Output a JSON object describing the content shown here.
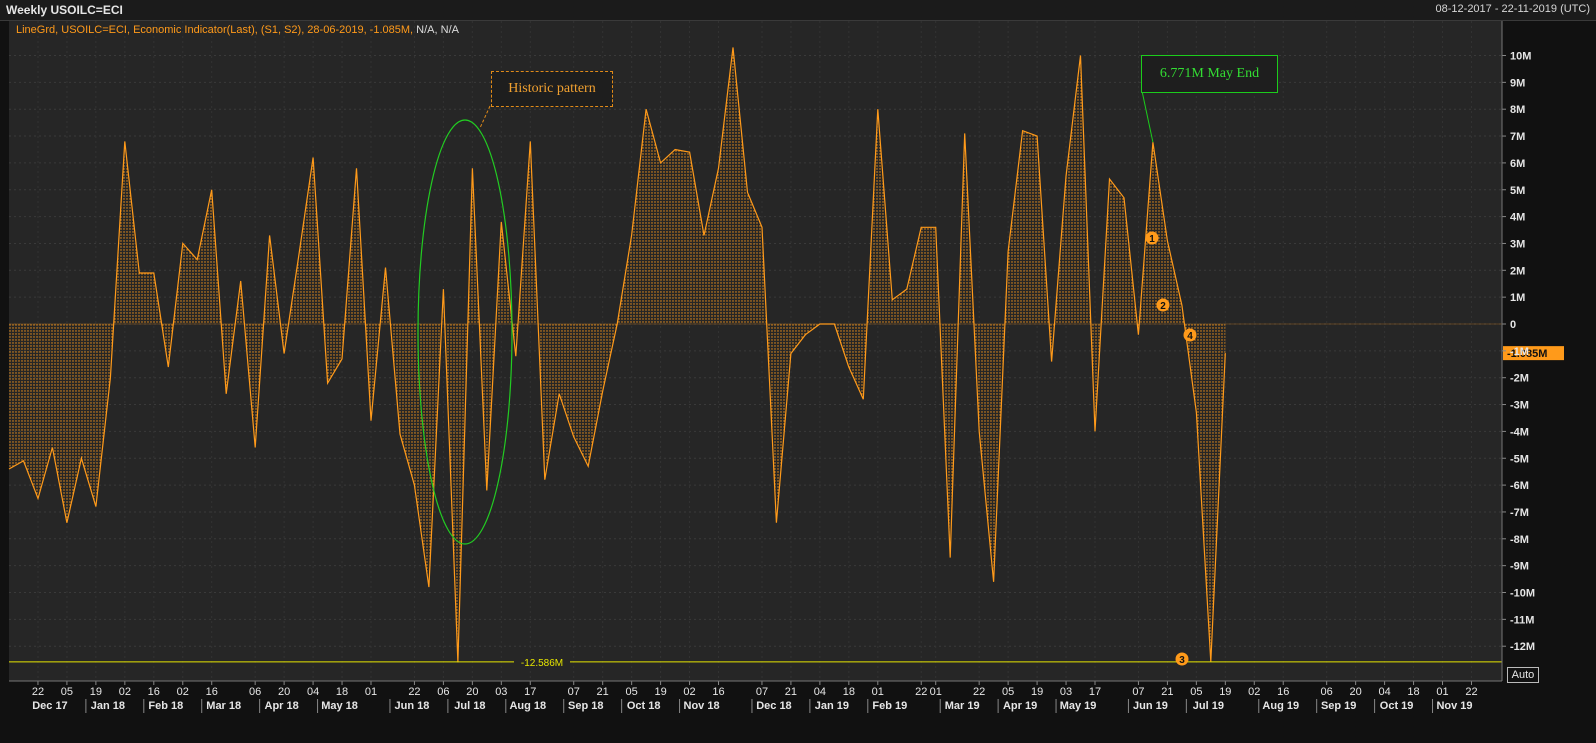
{
  "window": {
    "title": "Weekly USOILC=ECI",
    "date_range": "08-12-2017 - 22-11-2019 (UTC)"
  },
  "legend": {
    "text": "LineGrd, USOILC=ECI, Economic Indicator(Last), (S1, S2), 28-06-2019, -1.085M,",
    "na": "N/A, N/A"
  },
  "annotations": {
    "historic_pattern": "Historic pattern",
    "may_end": "6.771M May End",
    "min_line_label": "-12.586M",
    "last_value_label": "-1.085M",
    "markers": [
      "1",
      "2",
      "3",
      "4"
    ]
  },
  "auto_button": "Auto",
  "colors": {
    "series": "#ff9a1a",
    "ellipse": "#22cc22",
    "min_line": "#e6e600",
    "price_tag": "#ff9a1a"
  },
  "chart_data": {
    "type": "area",
    "title": "Weekly USOILC=ECI",
    "ylim": [
      -13,
      10.5
    ],
    "y_ticks": [
      "10M",
      "9M",
      "8M",
      "7M",
      "6M",
      "5M",
      "4M",
      "3M",
      "2M",
      "1M",
      "0",
      "-1M",
      "-2M",
      "-3M",
      "-4M",
      "-5M",
      "-6M",
      "-7M",
      "-8M",
      "-9M",
      "-10M",
      "-11M",
      "-12M"
    ],
    "y_tick_values": [
      10,
      9,
      8,
      7,
      6,
      5,
      4,
      3,
      2,
      1,
      0,
      -1,
      -2,
      -3,
      -4,
      -5,
      -6,
      -7,
      -8,
      -9,
      -10,
      -11,
      -12
    ],
    "x_day_ticks": [
      "22",
      "05",
      "19",
      "02",
      "16",
      "02",
      "16",
      "06",
      "20",
      "04",
      "18",
      "01",
      "22",
      "06",
      "20",
      "03",
      "17",
      "07",
      "21",
      "05",
      "19",
      "02",
      "16",
      "07",
      "21",
      "04",
      "18",
      "01",
      "22",
      "01",
      "22",
      "05",
      "19",
      "03",
      "17",
      "07",
      "21",
      "05",
      "19",
      "02",
      "16",
      "06",
      "20",
      "04",
      "18",
      "01",
      "22"
    ],
    "x_day_tick_index": [
      2,
      4,
      6,
      8,
      10,
      12,
      14,
      17,
      19,
      21,
      23,
      25,
      28,
      30,
      32,
      34,
      36,
      39,
      41,
      43,
      45,
      47,
      49,
      52,
      54,
      56,
      58,
      60,
      63,
      64,
      67,
      69,
      71,
      73,
      75,
      78,
      80,
      82,
      84,
      86,
      88,
      91,
      93,
      95,
      97,
      99,
      101
    ],
    "x_month_ticks": [
      "Dec 17",
      "Jan 18",
      "Feb 18",
      "Mar 18",
      "Apr 18",
      "May 18",
      "Jun 18",
      "Jul 18",
      "Aug 18",
      "Sep 18",
      "Oct 18",
      "Nov 18",
      "Dec 18",
      "Jan 19",
      "Feb 19",
      "Mar 19",
      "Apr 19",
      "May 19",
      "Jun 19",
      "Jul 19",
      "Aug 19",
      "Sep 19",
      "Oct 19",
      "Nov 19"
    ],
    "x_month_tick_index": [
      2,
      6,
      10,
      14,
      18,
      22,
      27,
      31,
      35,
      39,
      43,
      47,
      52,
      56,
      60,
      65,
      69,
      73,
      78,
      82,
      87,
      91,
      95,
      99
    ],
    "x_count": 103,
    "series": [
      {
        "name": "USOILC=ECI",
        "unit": "M",
        "values": [
          -5.4,
          -5.1,
          -6.5,
          -4.6,
          -7.4,
          -5.0,
          -6.8,
          -2.0,
          6.8,
          1.9,
          1.9,
          -1.6,
          3.0,
          2.4,
          5.0,
          -2.6,
          1.6,
          -4.6,
          3.3,
          -1.1,
          2.5,
          6.2,
          -2.2,
          -1.3,
          5.8,
          -3.6,
          2.1,
          -4.1,
          -6.0,
          -9.8,
          1.3,
          -12.6,
          5.8,
          -6.2,
          3.8,
          -1.2,
          6.8,
          -5.8,
          -2.6,
          -4.2,
          -5.3,
          -2.5,
          0.0,
          3.3,
          8.0,
          6.0,
          6.5,
          6.4,
          3.3,
          5.8,
          10.3,
          4.9,
          3.6,
          -7.4,
          -1.1,
          -0.4,
          0.0,
          0.0,
          -1.6,
          -2.8,
          8.0,
          0.9,
          1.3,
          3.6,
          3.6,
          -8.7,
          7.1,
          -4.0,
          -9.6,
          2.7,
          7.2,
          7.0,
          -1.4,
          5.5,
          10.0,
          -4.0,
          5.4,
          4.7,
          -0.4,
          6.771,
          3.1,
          0.7,
          -3.3,
          -12.586,
          -1.085
        ]
      }
    ],
    "min_value": -12.586,
    "last_value": -1.085,
    "last_date": "28-06-2019"
  }
}
